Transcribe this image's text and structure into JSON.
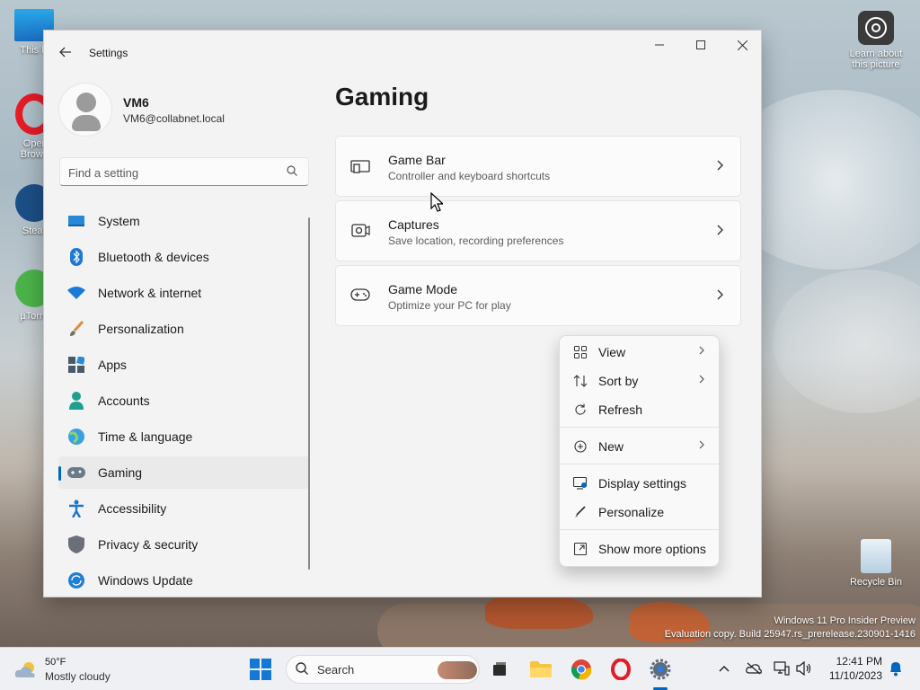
{
  "desktop": {
    "icons": [
      {
        "label": "This P"
      },
      {
        "label": "Oper\nBrows"
      },
      {
        "label": "Stear"
      },
      {
        "label": "µTorre"
      }
    ],
    "learn_label": "Learn about\nthis picture",
    "recycle_label": "Recycle Bin",
    "watermark_line1": "Windows 11 Pro Insider Preview",
    "watermark_line2": "Evaluation copy. Build 25947.rs_prerelease.230901-1416"
  },
  "window": {
    "title": "Settings",
    "controls": {
      "minimize": "—",
      "maximize": "□",
      "close": "✕"
    }
  },
  "profile": {
    "name": "VM6",
    "email": "VM6@collabnet.local"
  },
  "search": {
    "placeholder": "Find a setting"
  },
  "nav": {
    "items": [
      {
        "label": "System",
        "icon": "system-icon"
      },
      {
        "label": "Bluetooth & devices",
        "icon": "bluetooth-icon"
      },
      {
        "label": "Network & internet",
        "icon": "network-icon"
      },
      {
        "label": "Personalization",
        "icon": "brush-icon"
      },
      {
        "label": "Apps",
        "icon": "apps-icon"
      },
      {
        "label": "Accounts",
        "icon": "accounts-icon"
      },
      {
        "label": "Time & language",
        "icon": "globe-icon"
      },
      {
        "label": "Gaming",
        "icon": "gamepad-icon",
        "selected": true
      },
      {
        "label": "Accessibility",
        "icon": "accessibility-icon"
      },
      {
        "label": "Privacy & security",
        "icon": "shield-icon"
      },
      {
        "label": "Windows Update",
        "icon": "update-icon"
      }
    ]
  },
  "page": {
    "title": "Gaming",
    "cards": [
      {
        "title": "Game Bar",
        "subtitle": "Controller and keyboard shortcuts",
        "icon": "game-bar-icon"
      },
      {
        "title": "Captures",
        "subtitle": "Save location, recording preferences",
        "icon": "captures-icon"
      },
      {
        "title": "Game Mode",
        "subtitle": "Optimize your PC for play",
        "icon": "gamepad-icon"
      }
    ]
  },
  "context_menu": {
    "items": [
      {
        "label": "View",
        "icon": "grid-icon",
        "submenu": true
      },
      {
        "label": "Sort by",
        "icon": "sort-icon",
        "submenu": true
      },
      {
        "label": "Refresh",
        "icon": "refresh-icon",
        "submenu": false
      },
      {
        "label": "New",
        "icon": "plus-circle-icon",
        "submenu": true
      },
      {
        "label": "Display settings",
        "icon": "display-settings-icon",
        "submenu": false
      },
      {
        "label": "Personalize",
        "icon": "pen-icon",
        "submenu": false
      },
      {
        "label": "Show more options",
        "icon": "more-options-icon",
        "submenu": false
      }
    ]
  },
  "taskbar": {
    "weather_temp": "50°F",
    "weather_desc": "Mostly cloudy",
    "search_label": "Search",
    "clock_time": "12:41 PM",
    "clock_date": "11/10/2023",
    "accent": "#0067c0"
  }
}
